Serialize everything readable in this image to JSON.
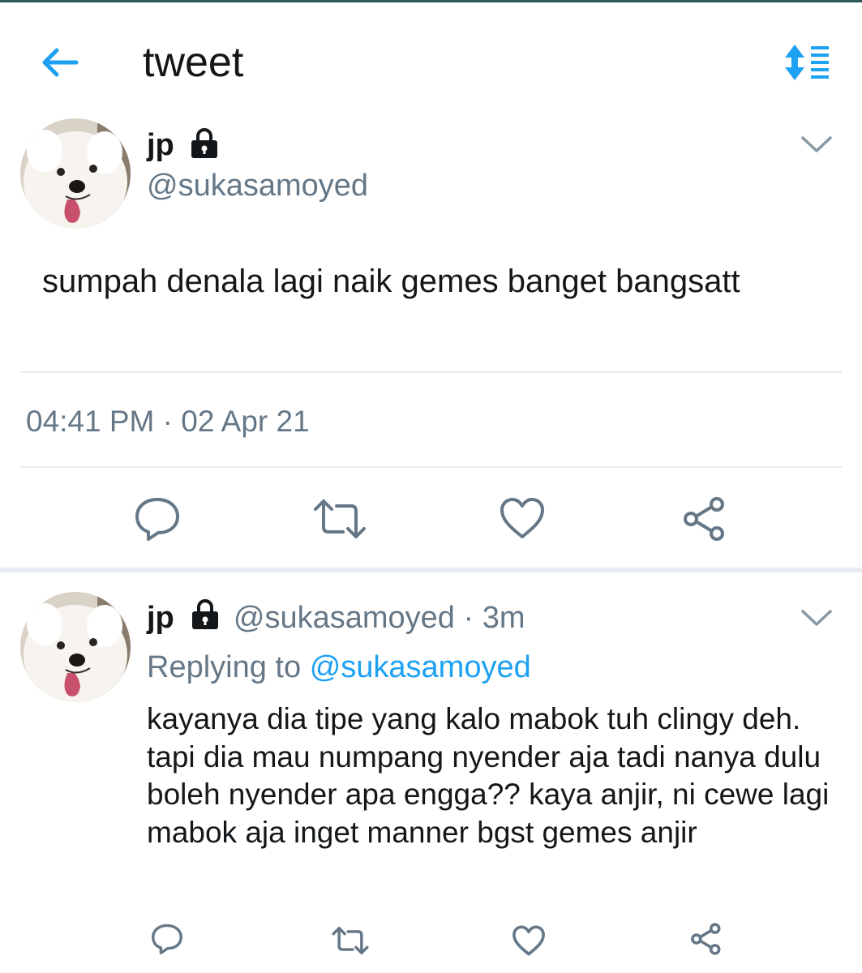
{
  "header": {
    "title": "tweet",
    "back_icon": "arrow-left-icon",
    "sort_icon": "sort-list-icon"
  },
  "tweet": {
    "author_name": "jp",
    "author_handle": "@sukasamoyed",
    "protected_icon": "lock-icon",
    "text": "sumpah denala lagi naik gemes banget bangsatt",
    "timestamp": "04:41 PM · 02 Apr 21",
    "actions": [
      "reply-icon",
      "retweet-icon",
      "like-icon",
      "share-icon"
    ]
  },
  "reply": {
    "author_name": "jp",
    "author_handle": "@sukasamoyed",
    "time_ago": "· 3m",
    "replying_prefix": "Replying to",
    "replying_to": "@sukasamoyed",
    "text": "kayanya dia tipe yang kalo mabok tuh clingy deh. tapi dia mau numpang nyender aja tadi nanya dulu boleh nyender apa engga?? kaya anjir, ni cewe lagi mabok aja inget manner bgst gemes anjir",
    "actions": [
      "reply-icon",
      "retweet-icon",
      "like-icon",
      "share-icon"
    ]
  },
  "colors": {
    "accent": "#1da1f2",
    "muted": "#657786",
    "text": "#14171a",
    "divider": "#e6ecf0"
  }
}
